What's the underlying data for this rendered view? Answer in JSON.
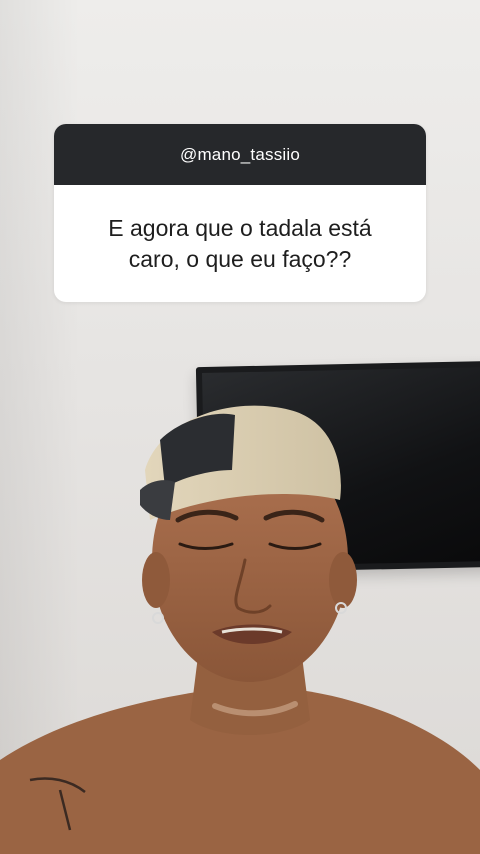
{
  "question_sticker": {
    "username": "@mano_tassiio",
    "question": "E agora que o tadala está caro, o que eu faço??"
  }
}
